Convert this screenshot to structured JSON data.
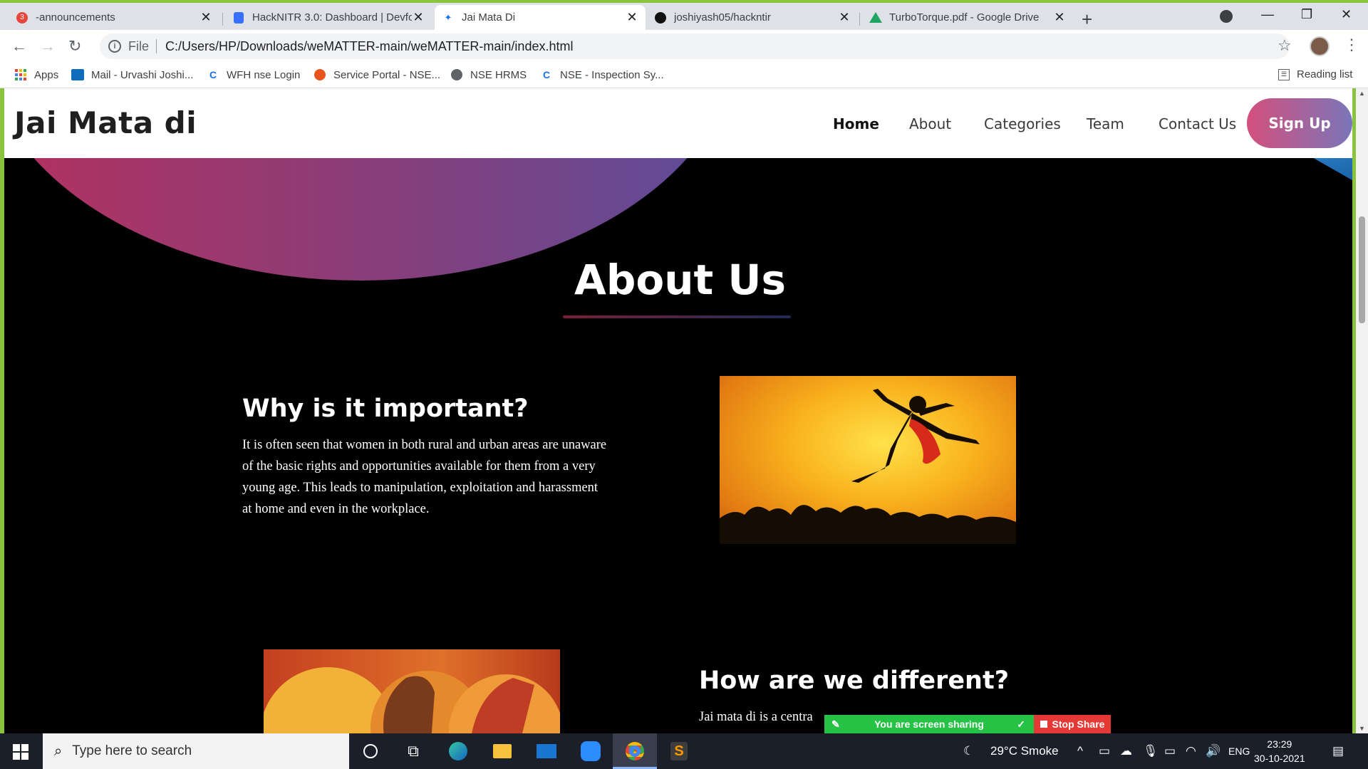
{
  "browser": {
    "tabs": [
      {
        "title": "-announcements",
        "badge": "3",
        "active": false
      },
      {
        "title": "HackNITR 3.0: Dashboard | Devfo",
        "active": false
      },
      {
        "title": "Jai Mata Di",
        "active": true
      },
      {
        "title": "joshiyash05/hackntir",
        "active": false
      },
      {
        "title": "TurboTorque.pdf - Google Drive",
        "active": false
      }
    ],
    "url_scheme": "File",
    "url": "C:/Users/HP/Downloads/weMATTER-main/weMATTER-main/index.html",
    "bookmarks": [
      {
        "label": "Apps",
        "icon": "apps-grid-icon"
      },
      {
        "label": "Mail - Urvashi Joshi...",
        "icon": "outlook-icon"
      },
      {
        "label": "WFH nse Login",
        "icon": "nse-icon"
      },
      {
        "label": "Service Portal - NSE...",
        "icon": "service-portal-icon"
      },
      {
        "label": "NSE HRMS",
        "icon": "globe-icon"
      },
      {
        "label": "NSE - Inspection Sy...",
        "icon": "nse-icon"
      }
    ],
    "reading_list": "Reading list"
  },
  "page": {
    "brand": "Jai Mata di",
    "nav": [
      "Home",
      "About",
      "Categories",
      "Team",
      "Contact Us"
    ],
    "active_nav": "Home",
    "signup": "Sign Up",
    "about_title": "About Us",
    "section1": {
      "heading": "Why is it important?",
      "body_lines": [
        "It is often seen that women in both rural and urban areas are unaware",
        "of the basic rights and opportunities available for them from a very",
        "young age. This leads to manipulation, exploitation and harassment",
        "at home and even in the workplace."
      ]
    },
    "section2": {
      "heading": "How are we different?",
      "body_visible": "Jai mata di is a centra"
    },
    "colors": {
      "arc_start": "#b5315f",
      "arc_end": "#5b4d9a",
      "signup_start": "#d3507c",
      "signup_end": "#7a76b9"
    }
  },
  "screen_share": {
    "status": "You are screen sharing",
    "stop": "Stop Share"
  },
  "taskbar": {
    "search_placeholder": "Type here to search",
    "weather": "29°C  Smoke",
    "lang": "ENG",
    "time": "23:29",
    "date": "30-10-2021"
  }
}
